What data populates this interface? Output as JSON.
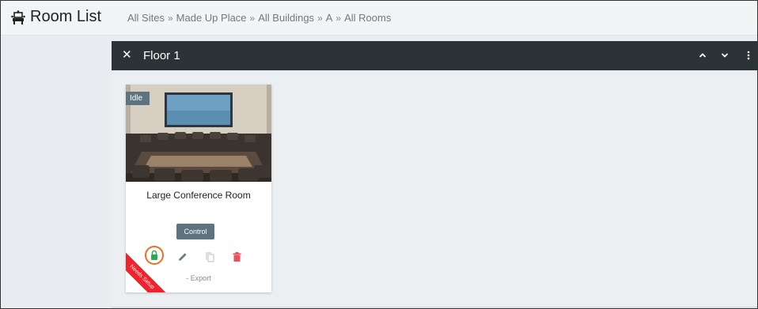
{
  "page": {
    "title": "Room List",
    "title_icon": "room-seating-icon"
  },
  "breadcrumb": {
    "items": [
      "All Sites",
      "Made Up Place",
      "All Buildings",
      "A",
      "All Rooms"
    ],
    "separator": "»"
  },
  "floor": {
    "title": "Floor 1",
    "close_icon": "close-icon",
    "controls": [
      "chevron-up-icon",
      "chevron-down-icon",
      "more-vert-icon"
    ]
  },
  "room_card": {
    "status": "Idle",
    "name": "Large Conference Room",
    "control_label": "Control",
    "export_label": "- Export",
    "ribbon_label": "Needs Setup",
    "actions": [
      "setup-lock-icon",
      "edit-icon",
      "copy-icon",
      "delete-icon"
    ]
  },
  "colors": {
    "header_bg": "#2b3337",
    "tag_bg": "#5d7480",
    "setup_green": "#2fa84f",
    "setup_ring": "#f26b21",
    "delete_red": "#ef4d57",
    "ribbon_red": "#f0222b"
  }
}
